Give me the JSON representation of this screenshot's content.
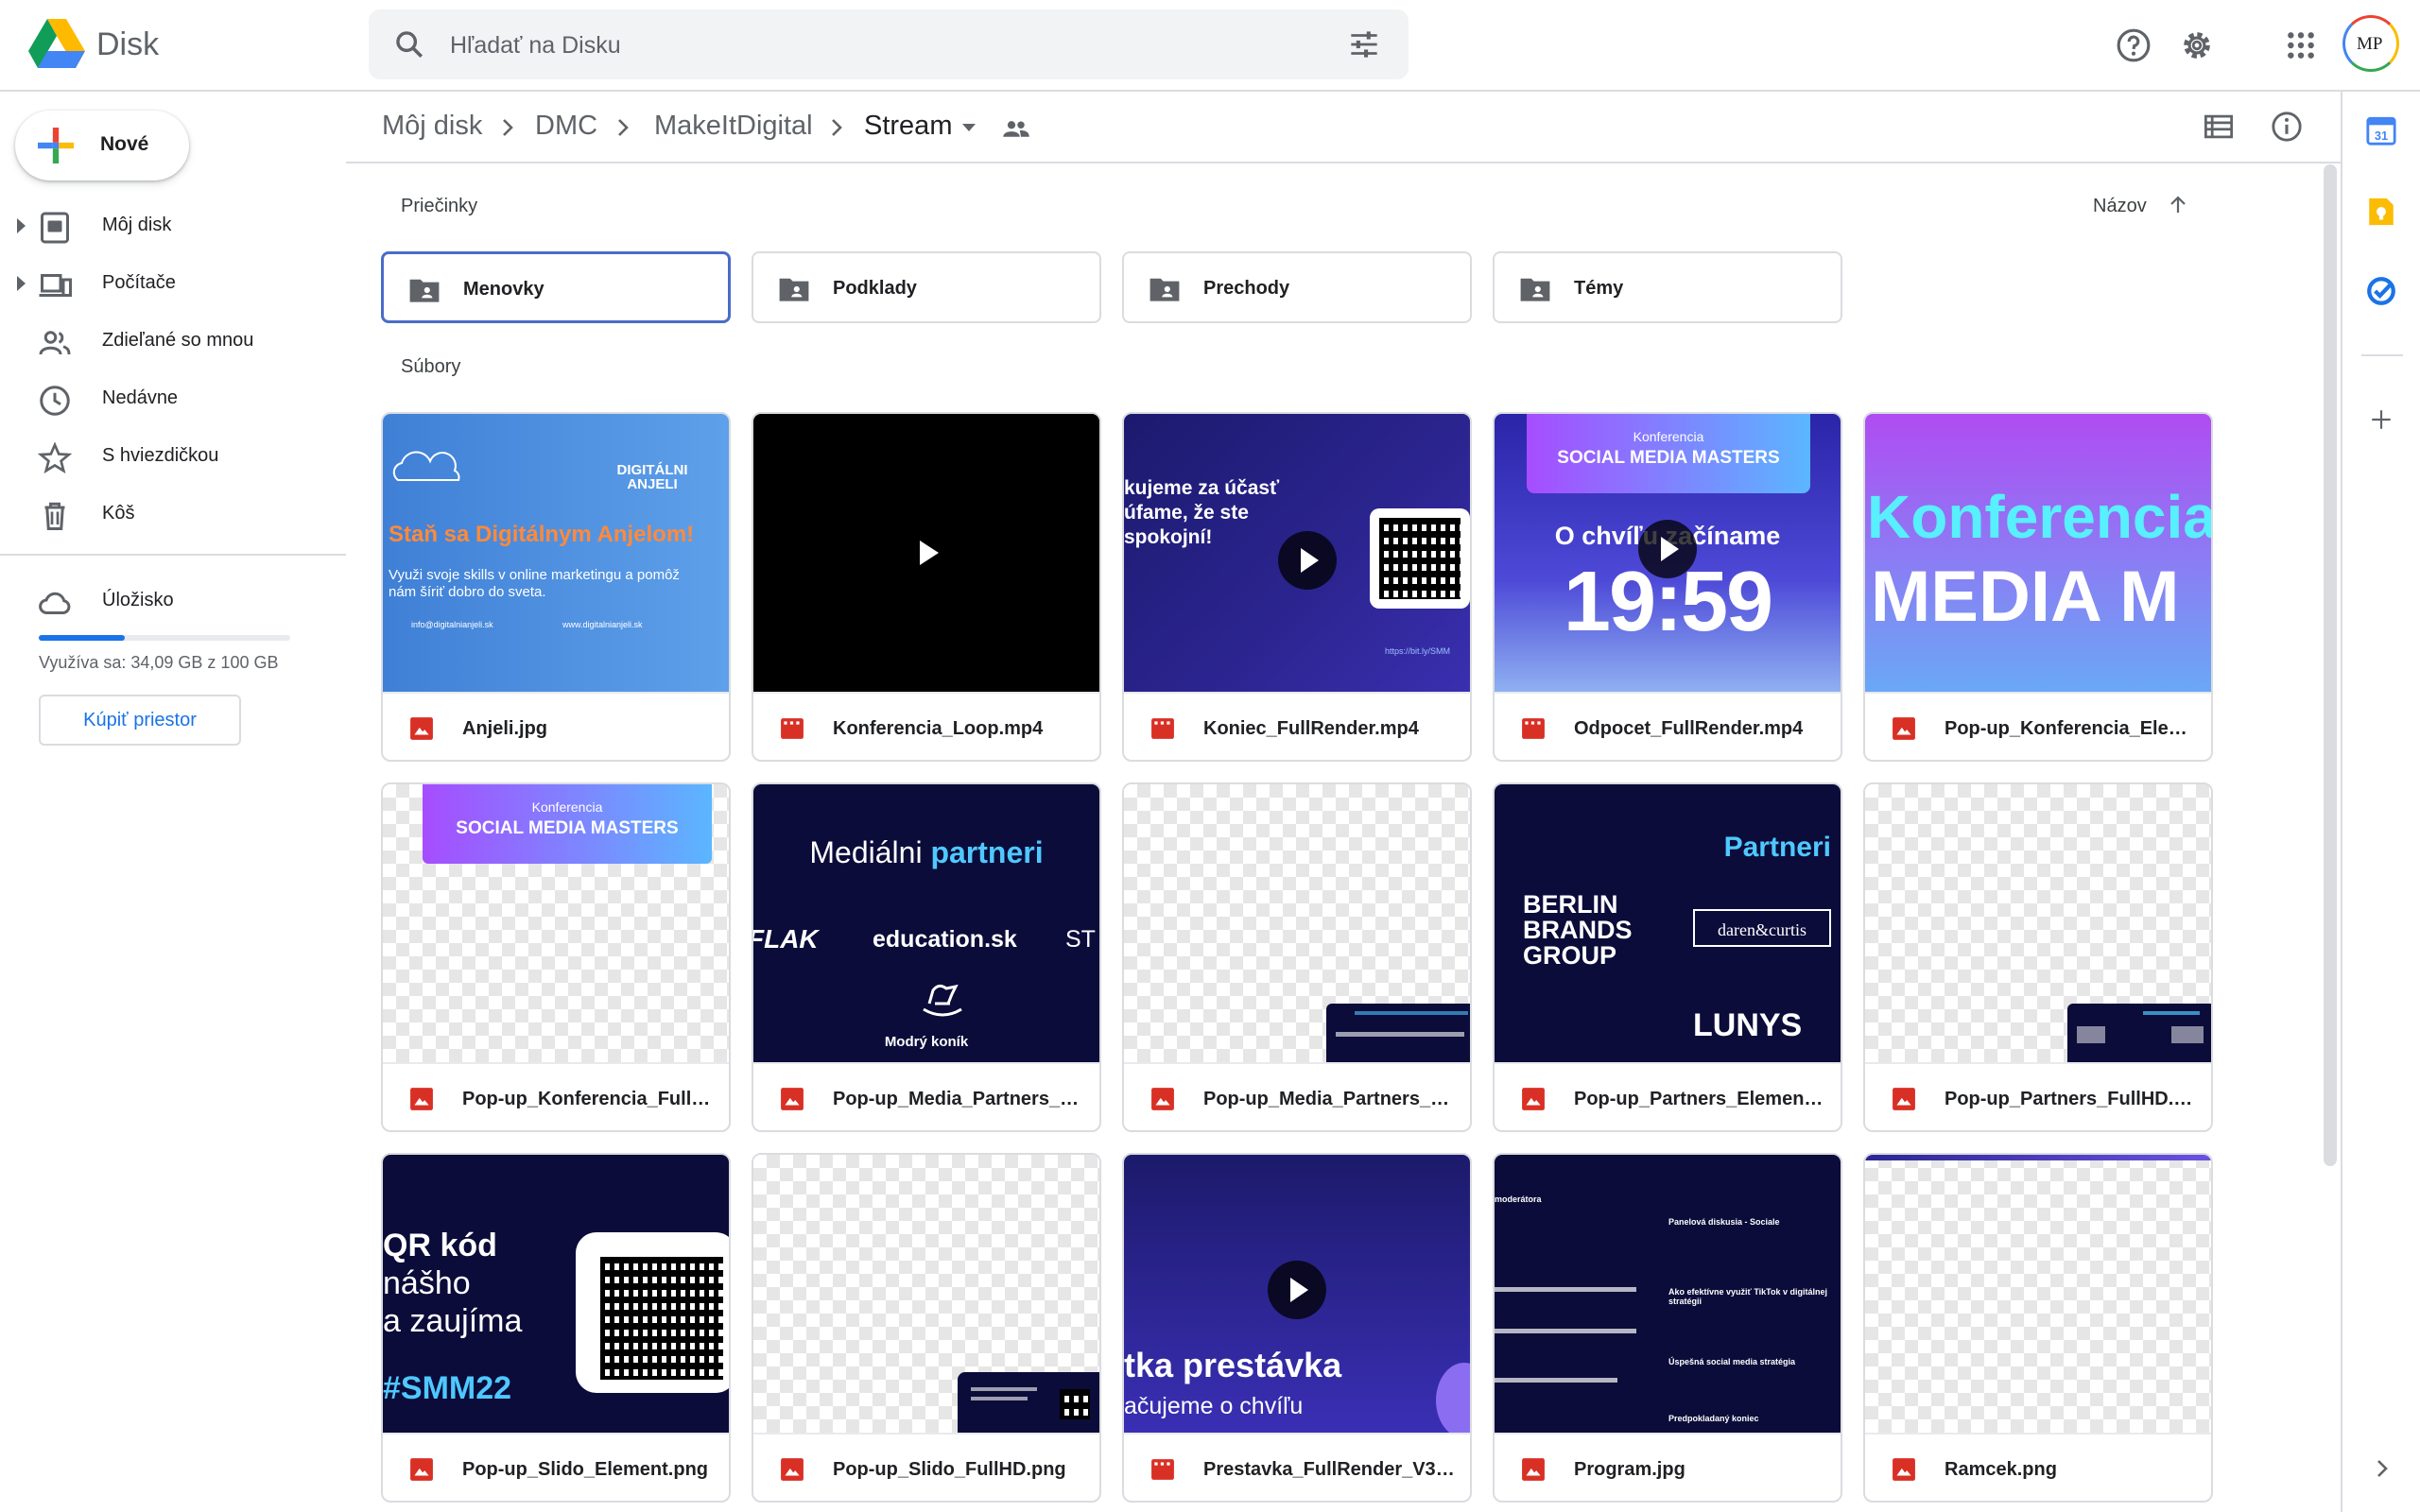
{
  "app": {
    "name": "Disk",
    "user_initials": "MP"
  },
  "search": {
    "placeholder": "Hľadať na Disku"
  },
  "sidebar": {
    "new_label": "Nové",
    "items": [
      {
        "label": "Môj disk",
        "icon": "my-drive-icon"
      },
      {
        "label": "Počítače",
        "icon": "computers-icon"
      },
      {
        "label": "Zdieľané so mnou",
        "icon": "shared-icon"
      },
      {
        "label": "Nedávne",
        "icon": "clock-icon"
      },
      {
        "label": "S hviezdičkou",
        "icon": "star-icon"
      },
      {
        "label": "Kôš",
        "icon": "trash-icon"
      }
    ],
    "storage": {
      "label": "Úložisko",
      "usage_text": "Využíva sa: 34,09 GB z 100 GB",
      "used_fraction": 0.3409,
      "buy_label": "Kúpiť priestor"
    }
  },
  "breadcrumb": [
    "Môj disk",
    "DMC",
    "MakeItDigital",
    "Stream"
  ],
  "sections": {
    "folders": "Priečinky",
    "files": "Súbory",
    "sort_label": "Názov"
  },
  "folders": [
    "Menovky",
    "Podklady",
    "Prechody",
    "Témy"
  ],
  "files": [
    {
      "name": "Anjeli.jpg",
      "type": "image"
    },
    {
      "name": "Konferencia_Loop.mp4",
      "type": "video"
    },
    {
      "name": "Koniec_FullRender.mp4",
      "type": "video"
    },
    {
      "name": "Odpocet_FullRender.mp4",
      "type": "video"
    },
    {
      "name": "Pop-up_Konferencia_Eleme...",
      "type": "image"
    },
    {
      "name": "Pop-up_Konferencia_FullHD...",
      "type": "image"
    },
    {
      "name": "Pop-up_Media_Partners_Ele...",
      "type": "image"
    },
    {
      "name": "Pop-up_Media_Partners_Ful...",
      "type": "image"
    },
    {
      "name": "Pop-up_Partners_Element.p...",
      "type": "image"
    },
    {
      "name": "Pop-up_Partners_FullHD.png",
      "type": "image"
    },
    {
      "name": "Pop-up_Slido_Element.png",
      "type": "image"
    },
    {
      "name": "Pop-up_Slido_FullHD.png",
      "type": "image"
    },
    {
      "name": "Prestavka_FullRender_V3.m...",
      "type": "video"
    },
    {
      "name": "Program.jpg",
      "type": "image"
    },
    {
      "name": "Ramcek.png",
      "type": "image"
    }
  ],
  "thumbs": {
    "anjeli": {
      "logo": "DIGITÁLNI ANJELI",
      "headline": "Staň sa Digitálnym Anjelom!",
      "body": "Využi svoje skills v online marketingu a pomôž nám šíriť dobro do sveta.",
      "email": "info@digitalnianjeli.sk",
      "web": "www.digitalnianjeli.sk"
    },
    "koniec": {
      "line1": "kujeme za účasť",
      "line2": "úfame, že ste",
      "line3": "spokojní!",
      "url": "https://bit.ly/SMM"
    },
    "odpocet": {
      "conf": "Konferencia",
      "title": "SOCIAL MEDIA MASTERS",
      "sub": "O chvíľu začíname",
      "time": "19:59"
    },
    "konf_element": {
      "l1": "Konferencia",
      "l2": "MEDIA M"
    },
    "konf_full": {
      "conf": "Konferencia",
      "title": "SOCIAL MEDIA MASTERS"
    },
    "media_partners": {
      "title1": "Mediálni ",
      "title2": "partneri",
      "p1": "FLAK",
      "p2": "education.sk",
      "p3": "ST",
      "p4": "Modrý koník"
    },
    "partners": {
      "title": "Partneri",
      "p1": "BERLIN BRANDS GROUP",
      "p2": "daren&curtis",
      "p3": "LUNYS"
    },
    "slido": {
      "l1": "QR kód",
      "l2": "nášho",
      "l3": "a zaujíma",
      "tag": "#SMM22"
    },
    "prestavka": {
      "l1": "tka prestávka",
      "l2": "ačujeme o chvíľu"
    },
    "program": {
      "c1": "moderátora",
      "c2": "Panelová diskusia - Sociale",
      "c3": "Ako efektívne využiť TikTok v digitálnej stratégii",
      "c4": "Úspešná social media stratégia",
      "c5": "Predpokladaný koniec"
    }
  },
  "colors": {
    "accent": "#1a73e8",
    "image_icon": "#d93025",
    "video_icon": "#d93025"
  }
}
